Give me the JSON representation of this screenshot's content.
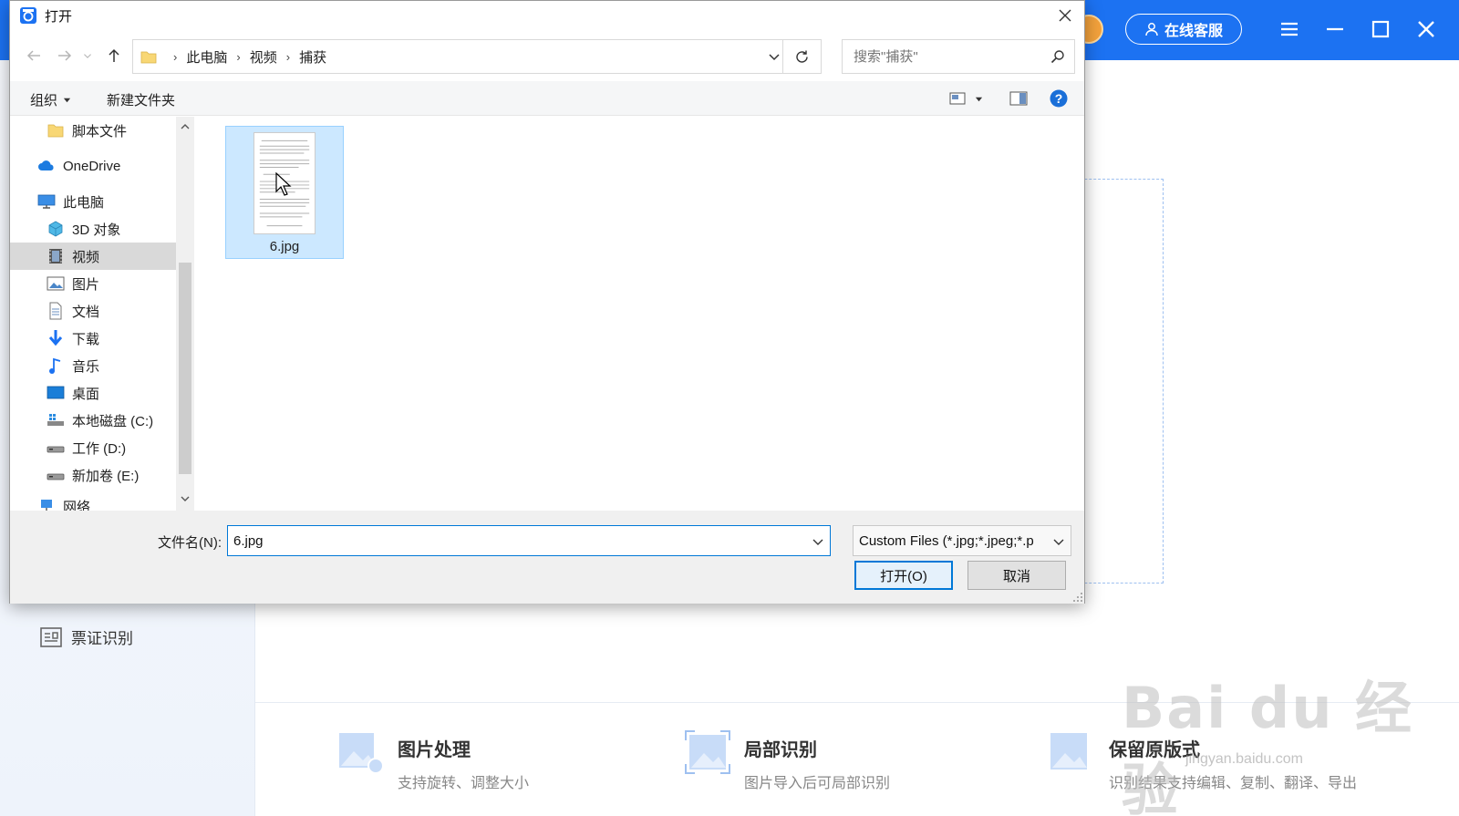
{
  "app": {
    "service_button": "在线客服",
    "sidebar_visible_item": "票证识别",
    "features": [
      {
        "title": "图片处理",
        "desc": "支持旋转、调整大小"
      },
      {
        "title": "局部识别",
        "desc": "图片导入后可局部识别"
      },
      {
        "title": "保留原版式",
        "desc": "识别结果支持编辑、复制、翻译、导出"
      }
    ],
    "watermark": "Bai du 经验",
    "watermark_url": "jingyan.baidu.com",
    "colors": {
      "brand_blue": "#1c72f2"
    }
  },
  "dialog": {
    "title": "打开",
    "breadcrumbs": [
      "此电脑",
      "视频",
      "捕获"
    ],
    "search_placeholder": "搜索\"捕获\"",
    "toolbar": {
      "organize": "组织",
      "new_folder": "新建文件夹"
    },
    "nav_items": [
      {
        "label": "脚本文件",
        "icon": "folder-icon"
      },
      {
        "label": "OneDrive",
        "icon": "cloud-icon"
      },
      {
        "label": "此电脑",
        "icon": "computer-icon"
      },
      {
        "label": "3D 对象",
        "icon": "cube-icon"
      },
      {
        "label": "视频",
        "icon": "video-icon",
        "selected": true
      },
      {
        "label": "图片",
        "icon": "picture-icon"
      },
      {
        "label": "文档",
        "icon": "document-icon"
      },
      {
        "label": "下载",
        "icon": "download-icon"
      },
      {
        "label": "音乐",
        "icon": "music-icon"
      },
      {
        "label": "桌面",
        "icon": "desktop-icon"
      },
      {
        "label": "本地磁盘 (C:)",
        "icon": "drive-c-icon"
      },
      {
        "label": "工作 (D:)",
        "icon": "drive-icon"
      },
      {
        "label": "新加卷 (E:)",
        "icon": "drive-icon"
      },
      {
        "label": "网络",
        "icon": "network-icon"
      }
    ],
    "files": [
      {
        "name": "6.jpg",
        "selected": true
      }
    ],
    "filename_label": "文件名(N):",
    "filename_value": "6.jpg",
    "filetype_value": "Custom Files (*.jpg;*.jpeg;*.p",
    "open_button": "打开(O)",
    "cancel_button": "取消"
  }
}
